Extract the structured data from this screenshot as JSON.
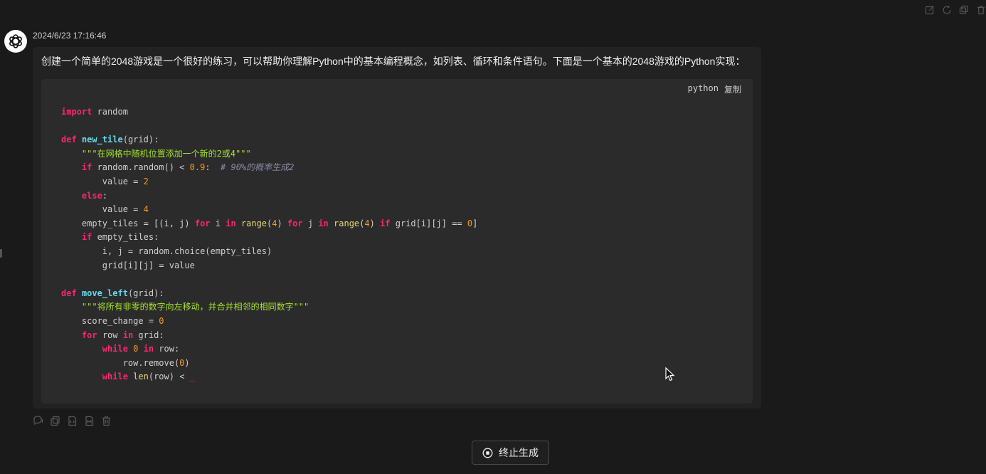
{
  "message": {
    "timestamp": "2024/6/23 17:16:46",
    "text": "创建一个简单的2048游戏是一个很好的练习，可以帮助你理解Python中的基本编程概念，如列表、循环和条件语句。下面是一个基本的2048游戏的Python实现："
  },
  "code_block": {
    "language": "python",
    "copy_label": "复制",
    "docstring_1": "\"\"\"在网格中随机位置添加一个新的2或4\"\"\"",
    "comment_1": "# 90%的概率生成2",
    "docstring_2": "\"\"\"将所有非零的数字向左移动，并合并相邻的相同数字\"\"\""
  },
  "stop_button": {
    "label": "终止生成"
  },
  "icons": {
    "top_toolbar": [
      "edit-icon",
      "refresh-icon",
      "copy-icon",
      "delete-icon"
    ],
    "message_actions": [
      "speak-icon",
      "copy-icon",
      "code-icon",
      "markdown-icon",
      "delete-icon"
    ],
    "stop": "stop-circle-icon"
  }
}
